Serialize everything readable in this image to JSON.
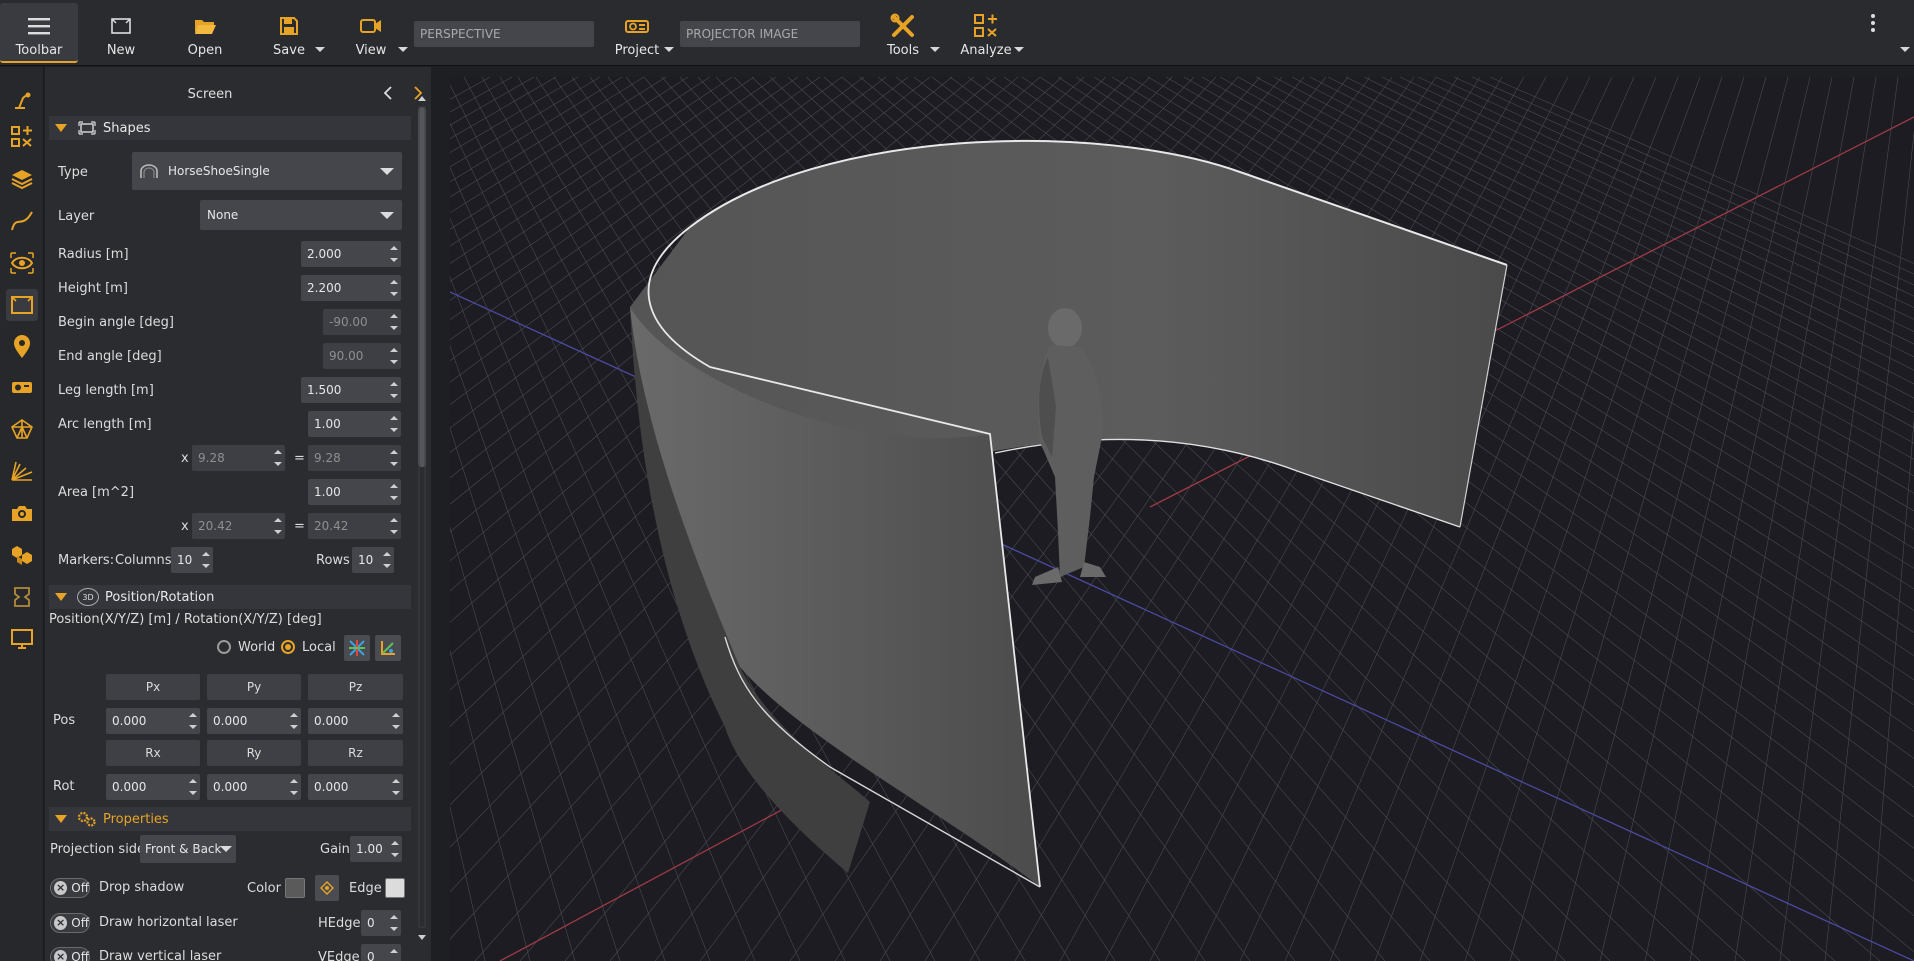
{
  "toolbar": {
    "toolbar_label": "Toolbar",
    "new_label": "New",
    "open_label": "Open",
    "save_label": "Save",
    "view_label": "View",
    "perspective_field": "PERSPECTIVE",
    "project_label": "Project",
    "projector_image_field": "PROJECTOR IMAGE",
    "tools_label": "Tools",
    "analyze_label": "Analyze"
  },
  "sidebar_icons": [
    "lamp-icon",
    "tools-grid-icon",
    "layers-icon",
    "curve-icon",
    "eye-icon",
    "screen-icon",
    "location-pin-icon",
    "projector-icon",
    "mesh-icon",
    "analysis-icon",
    "camera-icon",
    "objects-icon",
    "plugin-icon",
    "monitor-icon"
  ],
  "panel": {
    "title": "Screen",
    "shapes": {
      "header": "Shapes",
      "type_label": "Type",
      "type_value": "HorseShoeSingle",
      "layer_label": "Layer",
      "layer_value": "None",
      "radius_label": "Radius  [m]",
      "radius_value": "2.000",
      "height_label": "Height  [m]",
      "height_value": "2.200",
      "begin_angle_label": "Begin angle [deg]",
      "begin_angle_value": "-90.00",
      "end_angle_label": "End angle [deg]",
      "end_angle_value": "90.00",
      "leg_length_label": "Leg length  [m]",
      "leg_length_value": "1.500",
      "arc_length_label": "Arc length  [m]",
      "arc_length_value": "1.00",
      "arc_x_sign": "x",
      "arc_x_value": "9.28",
      "arc_eq_sign": "=",
      "arc_eq_value": "9.28",
      "area_label": "Area  [m^2]",
      "area_value": "1.00",
      "area_x_sign": "x",
      "area_x_value": "20.42",
      "area_eq_sign": "=",
      "area_eq_value": "20.42",
      "markers_label": "Markers:",
      "columns_label": "Columns",
      "columns_value": "10",
      "rows_label": "Rows",
      "rows_value": "10"
    },
    "position": {
      "header": "Position/Rotation",
      "header_badge": "3D",
      "subtitle": "Position(X/Y/Z) [m] / Rotation(X/Y/Z) [deg]",
      "world_label": "World",
      "local_label": "Local",
      "px": "Px",
      "py": "Py",
      "pz": "Pz",
      "pos_label": "Pos",
      "pos_x": "0.000",
      "pos_y": "0.000",
      "pos_z": "0.000",
      "rx": "Rx",
      "ry": "Ry",
      "rz": "Rz",
      "rot_label": "Rot",
      "rot_x": "0.000",
      "rot_y": "0.000",
      "rot_z": "0.000"
    },
    "properties": {
      "header": "Properties",
      "projection_side_label": "Projection side",
      "projection_side_value": "Front & Back",
      "gain_label": "Gain",
      "gain_value": "1.00",
      "toggle_off": "Off",
      "drop_shadow_label": "Drop shadow",
      "color_label": "Color",
      "edge_label": "Edge",
      "draw_horizontal_laser_label": "Draw horizontal laser",
      "hedge_label": "HEdge",
      "hedge_value": "0",
      "draw_vertical_laser_label": "Draw vertical laser",
      "vedge_label": "VEdge",
      "vedge_value": "0"
    }
  },
  "colors": {
    "accent": "#e7a325",
    "background": "#1e1f23",
    "panel": "#2b2c30",
    "viewport": "#1c1c22",
    "grid": "#4a4a52",
    "axis_red": "#b0404a",
    "axis_blue": "#4a4aa0",
    "screen_surface": "#5b5b5b"
  }
}
